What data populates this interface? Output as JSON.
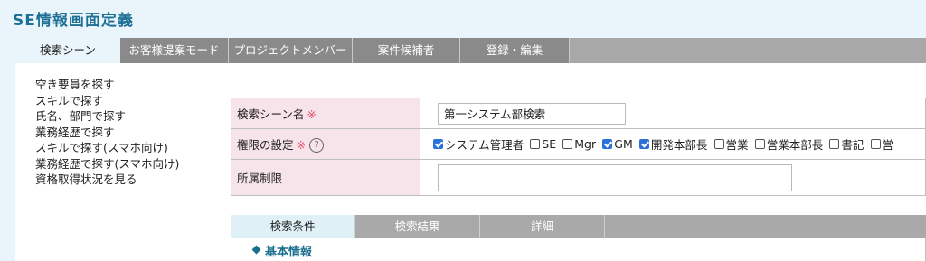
{
  "page": {
    "title": "SE情報画面定義"
  },
  "top_tabs": [
    {
      "label": "検索シーン",
      "active": true
    },
    {
      "label": "お客様提案モード",
      "active": false
    },
    {
      "label": "プロジェクトメンバー",
      "active": false
    },
    {
      "label": "案件候補者",
      "active": false
    },
    {
      "label": "登録・編集",
      "active": false
    }
  ],
  "side_menu": [
    "空き要員を探す",
    "スキルで探す",
    "氏名、部門で探す",
    "業務経歴で探す",
    "スキルで探す(スマホ向け)",
    "業務経歴で探す(スマホ向け)",
    "資格取得状況を見る"
  ],
  "form": {
    "scene_name": {
      "label": "検索シーン名",
      "required_mark": "※",
      "value": "第一システム部検索"
    },
    "permissions": {
      "label": "権限の設定",
      "required_mark": "※",
      "help": "?",
      "options": [
        {
          "label": "システム管理者",
          "checked": true
        },
        {
          "label": "SE",
          "checked": false
        },
        {
          "label": "Mgr",
          "checked": false
        },
        {
          "label": "GM",
          "checked": true
        },
        {
          "label": "開発本部長",
          "checked": true
        },
        {
          "label": "営業",
          "checked": false
        },
        {
          "label": "営業本部長",
          "checked": false
        },
        {
          "label": "書記",
          "checked": false
        },
        {
          "label": "営",
          "checked": false
        }
      ]
    },
    "affiliation": {
      "label": "所属制限",
      "value": ""
    }
  },
  "sub_tabs": [
    {
      "label": "検索条件",
      "active": true
    },
    {
      "label": "検索結果",
      "active": false
    },
    {
      "label": "詳細",
      "active": false
    }
  ],
  "section": {
    "title": "基本情報"
  },
  "colors": {
    "title": "#1d6f95",
    "required": "#e8506e",
    "checked": "#2a72d8",
    "label_bg": "#f7e3ea"
  }
}
